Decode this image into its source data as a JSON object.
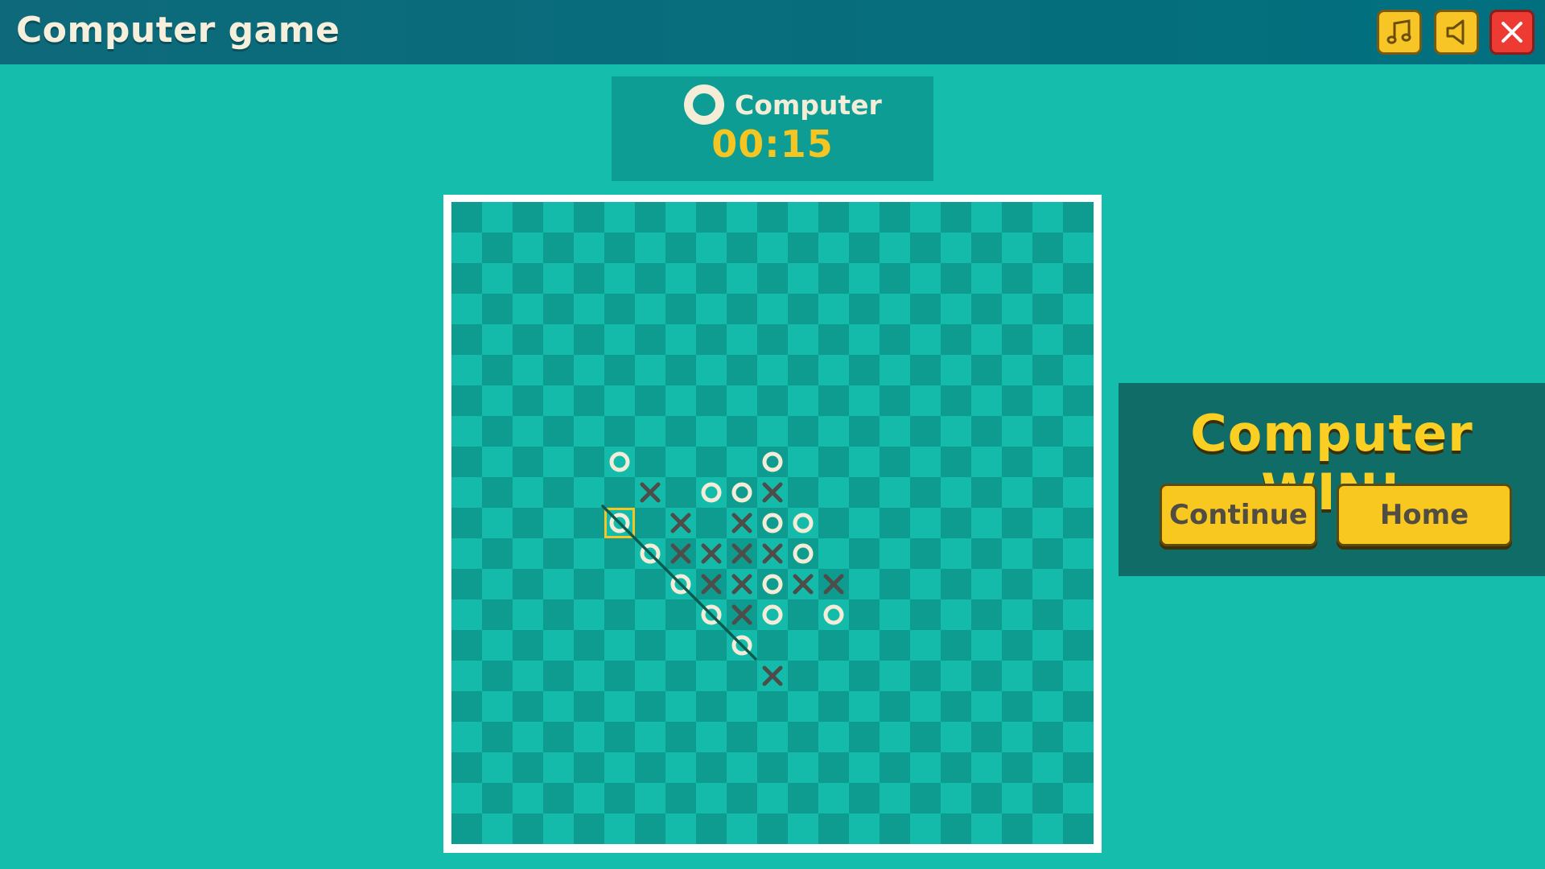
{
  "header": {
    "title": "Computer game"
  },
  "toolbar": {
    "music_icon": "music-note-icon",
    "sound_icon": "speaker-icon",
    "close_icon": "close-x-icon"
  },
  "turn": {
    "player": "Computer",
    "timer": "00:15",
    "piece": "O"
  },
  "result": {
    "message": "Computer WIN!",
    "continue_label": "Continue",
    "home_label": "Home"
  },
  "board": {
    "size": 21,
    "pieces_o": [
      [
        5,
        8
      ],
      [
        10,
        8
      ],
      [
        8,
        9
      ],
      [
        9,
        9
      ],
      [
        5,
        10
      ],
      [
        10,
        10
      ],
      [
        11,
        10
      ],
      [
        6,
        11
      ],
      [
        11,
        11
      ],
      [
        7,
        12
      ],
      [
        10,
        12
      ],
      [
        8,
        13
      ],
      [
        10,
        13
      ],
      [
        12,
        13
      ],
      [
        9,
        14
      ]
    ],
    "pieces_x": [
      [
        6,
        9
      ],
      [
        10,
        9
      ],
      [
        7,
        10
      ],
      [
        9,
        10
      ],
      [
        7,
        11
      ],
      [
        8,
        11
      ],
      [
        9,
        11
      ],
      [
        10,
        11
      ],
      [
        8,
        12
      ],
      [
        9,
        12
      ],
      [
        11,
        12
      ],
      [
        12,
        12
      ],
      [
        9,
        13
      ],
      [
        10,
        15
      ]
    ],
    "last_move": [
      5,
      10
    ],
    "win_line": {
      "from": [
        5,
        10
      ],
      "to": [
        9,
        14
      ]
    }
  },
  "colors": {
    "background": "#15bdad",
    "board_light": "#14bbab",
    "board_dark": "#0e9c91",
    "o_piece": "#f3ecd6",
    "x_piece": "#4d4d49",
    "highlight": "#f5c521",
    "win_line": "#0b5a4f"
  }
}
